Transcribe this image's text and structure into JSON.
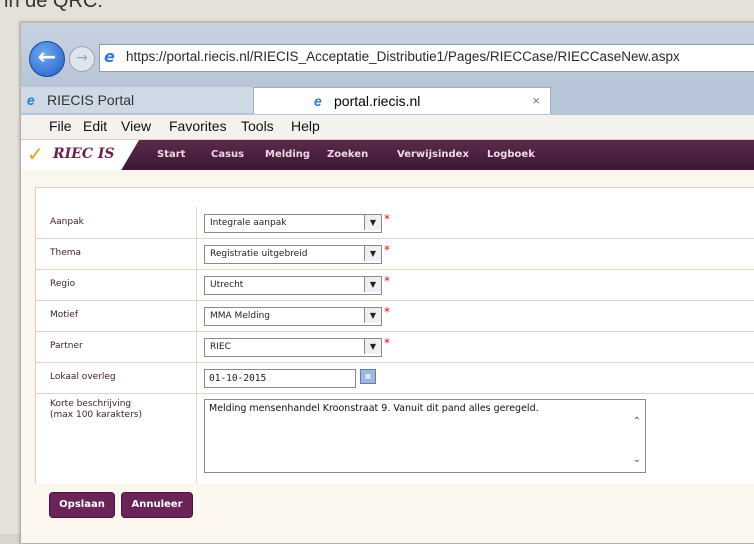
{
  "page_header_text": "in de QRC:",
  "browser": {
    "address": "https://portal.riecis.nl/RIECIS_Acceptatie_Distributie1/Pages/RIECCase/RIECCaseNew.aspx",
    "tabs": [
      {
        "label": "RIECIS Portal"
      },
      {
        "label": "portal.riecis.nl",
        "close": "×"
      }
    ],
    "menu": [
      "File",
      "Edit",
      "View",
      "Favorites",
      "Tools",
      "Help"
    ]
  },
  "app": {
    "logo_text": "RIEC IS",
    "nav": [
      "Start",
      "Casus",
      "Melding",
      "Zoeken",
      "Verwijsindex",
      "Logboek"
    ]
  },
  "form": {
    "rows": [
      {
        "label": "Aanpak",
        "value": "Integrale aanpak",
        "required": "*"
      },
      {
        "label": "Thema",
        "value": "Registratie uitgebreid",
        "required": "*"
      },
      {
        "label": "Regio",
        "value": "Utrecht",
        "required": "*"
      },
      {
        "label": "Motief",
        "value": "MMA Melding",
        "required": "*"
      },
      {
        "label": "Partner",
        "value": "RIEC",
        "required": "*"
      }
    ],
    "lokaal_label": "Lokaal overleg",
    "lokaal_value": "01-10-2015",
    "beschrijving_label_1": "Korte beschrijving",
    "beschrijving_label_2": "(max 100 karakters)",
    "beschrijving_value": "Melding mensenhandel Kroonstraat 9. Vanuit dit pand alles geregeld."
  },
  "buttons": {
    "save": "Opslaan",
    "cancel": "Annuleer"
  }
}
